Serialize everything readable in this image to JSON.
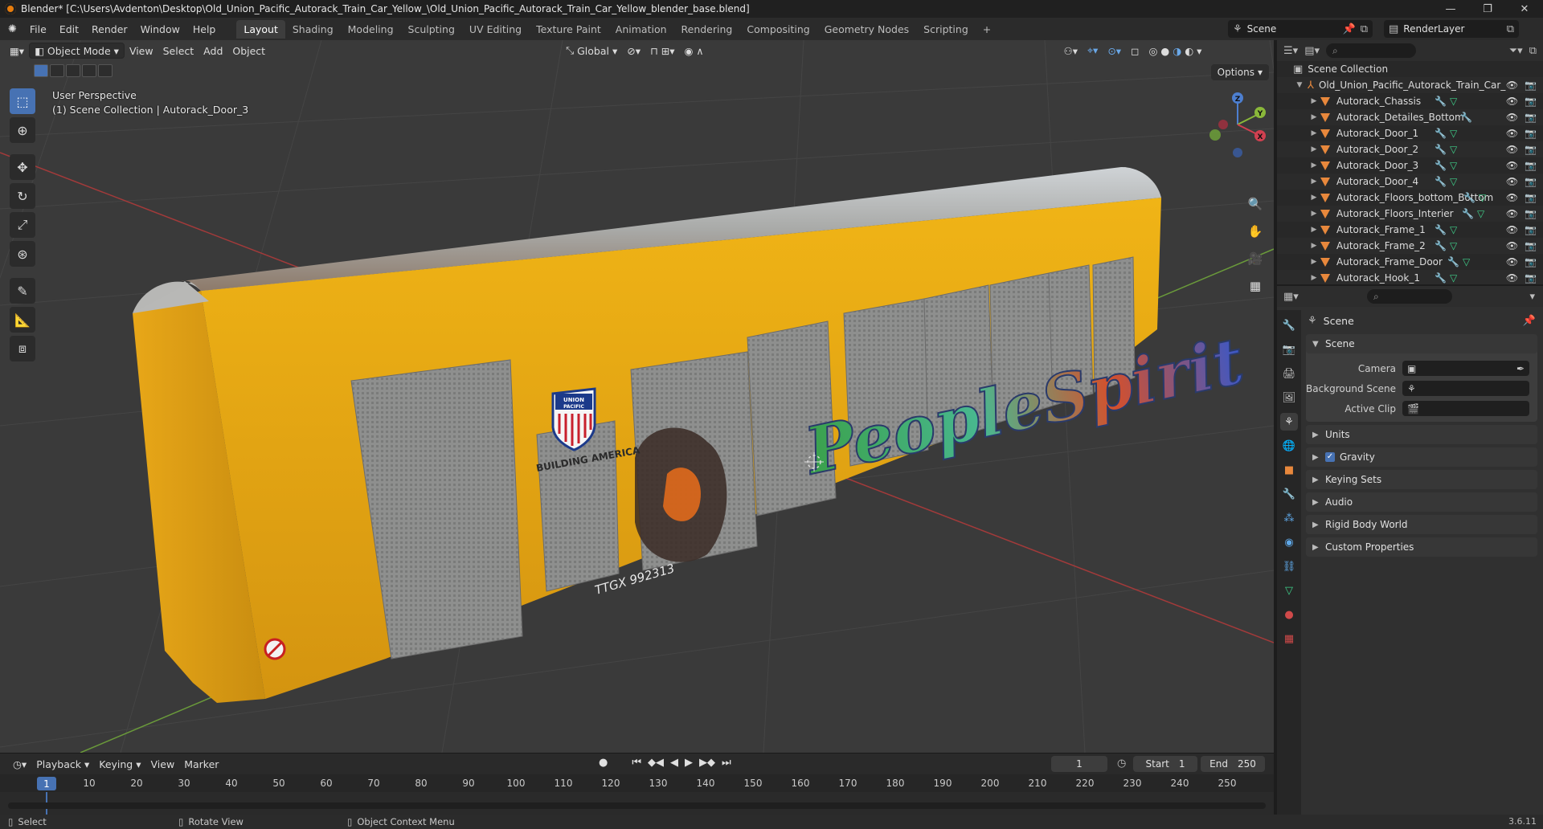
{
  "window": {
    "title": "Blender* [C:\\Users\\Avdenton\\Desktop\\Old_Union_Pacific_Autorack_Train_Car_Yellow_\\Old_Union_Pacific_Autorack_Train_Car_Yellow_blender_base.blend]",
    "minimize": "—",
    "maximize": "❐",
    "close": "✕"
  },
  "menu": [
    "File",
    "Edit",
    "Render",
    "Window",
    "Help"
  ],
  "workspaces": [
    "Layout",
    "Shading",
    "Modeling",
    "Sculpting",
    "UV Editing",
    "Texture Paint",
    "Animation",
    "Rendering",
    "Compositing",
    "Geometry Nodes",
    "Scripting"
  ],
  "workspace_add": "+",
  "scene_field": "Scene",
  "renderlayer_field": "RenderLayer",
  "viewport": {
    "mode": "Object Mode",
    "menus": [
      "View",
      "Select",
      "Add",
      "Object"
    ],
    "transform_orientation": "Global",
    "options": "Options",
    "perspective": "User Perspective",
    "collection_info": "(1) Scene Collection | Autorack_Door_3",
    "gizmo_axes": {
      "x": "X",
      "y": "Y",
      "z": "Z"
    }
  },
  "timeline": {
    "menus": [
      "Playback",
      "Keying",
      "View",
      "Marker"
    ],
    "current_frame": "1",
    "frame_field": "1",
    "start_label": "Start",
    "start_value": "1",
    "end_label": "End",
    "end_value": "250",
    "ticks": [
      "10",
      "20",
      "30",
      "40",
      "50",
      "60",
      "70",
      "80",
      "90",
      "100",
      "110",
      "120",
      "130",
      "140",
      "150",
      "160",
      "170",
      "180",
      "190",
      "200",
      "210",
      "220",
      "230",
      "240",
      "250"
    ]
  },
  "statusbar": {
    "select": "Select",
    "rotate": "Rotate View",
    "context": "Object Context Menu",
    "version": "3.6.11"
  },
  "outliner": {
    "root": "Scene Collection",
    "collection": "Old_Union_Pacific_Autorack_Train_Car_",
    "items": [
      {
        "name": "Autorack_Chassis"
      },
      {
        "name": "Autorack_Detailes_Bottom"
      },
      {
        "name": "Autorack_Door_1"
      },
      {
        "name": "Autorack_Door_2"
      },
      {
        "name": "Autorack_Door_3"
      },
      {
        "name": "Autorack_Door_4"
      },
      {
        "name": "Autorack_Floors_bottom_Bottom"
      },
      {
        "name": "Autorack_Floors_Interier"
      },
      {
        "name": "Autorack_Frame_1"
      },
      {
        "name": "Autorack_Frame_2"
      },
      {
        "name": "Autorack_Frame_Door"
      },
      {
        "name": "Autorack_Hook_1"
      }
    ]
  },
  "properties": {
    "context": "Scene",
    "panel_title": "Scene",
    "fields": [
      {
        "label": "Camera"
      },
      {
        "label": "Background Scene"
      },
      {
        "label": "Active Clip"
      }
    ],
    "subpanels": [
      "Units",
      "Gravity",
      "Keying Sets",
      "Audio",
      "Rigid Body World",
      "Custom Properties"
    ]
  },
  "car_markings": {
    "logo_top": "UNION",
    "logo_bottom": "PACIFIC",
    "slogan": "BUILDING AMERICA",
    "reporting_mark": "TTGX 992313",
    "graffiti": "PeopleSpirit"
  }
}
